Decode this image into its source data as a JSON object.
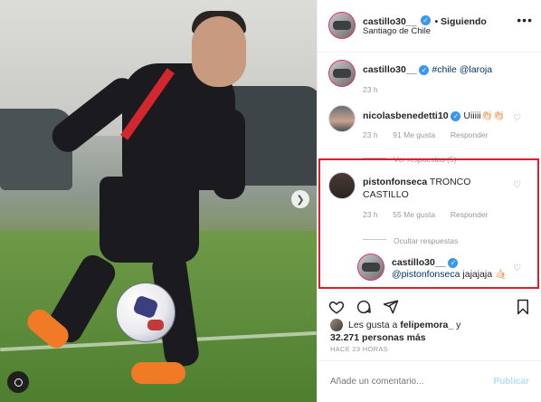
{
  "post": {
    "author": "castillo30__",
    "follow_status": "Siguiendo",
    "location": "Santiago de Chile",
    "caption_hashtag": "#chile",
    "caption_mention": "@laroja",
    "caption_time": "23 h"
  },
  "comments": [
    {
      "user": "nicolasbenedetti10",
      "verified": true,
      "text": "Uiiiii👏🏻👏🏻",
      "time": "23 h",
      "likes": "91 Me gusta",
      "reply": "Responder",
      "view_replies": "Ver respuestas (5)"
    },
    {
      "user": "pistonfonseca",
      "text": "TRONCO CASTILLO",
      "time": "23 h",
      "likes": "55 Me gusta",
      "reply": "Responder",
      "hide_replies": "Ocultar respuestas",
      "replies": [
        {
          "user": "castillo30__",
          "verified": true,
          "mention": "@pistonfonseca",
          "text": "jajajaja 🤙🏻"
        }
      ]
    }
  ],
  "likes_summary": {
    "prefix": "Les gusta a",
    "user": "felipemora_",
    "connector": "y",
    "count": "32.271 personas más"
  },
  "time_ago": "HACE 23 HORAS",
  "comment_box": {
    "placeholder": "Añade un comentario...",
    "publish": "Publicar"
  },
  "icons": {
    "options": "more-options-icon",
    "like": "heart-icon",
    "comment": "comment-icon",
    "share": "share-icon",
    "save": "bookmark-icon"
  },
  "colors": {
    "verified": "#3897f0",
    "highlight": "#e01e29",
    "link": "#003569",
    "publish_disabled": "#b2dffc"
  }
}
